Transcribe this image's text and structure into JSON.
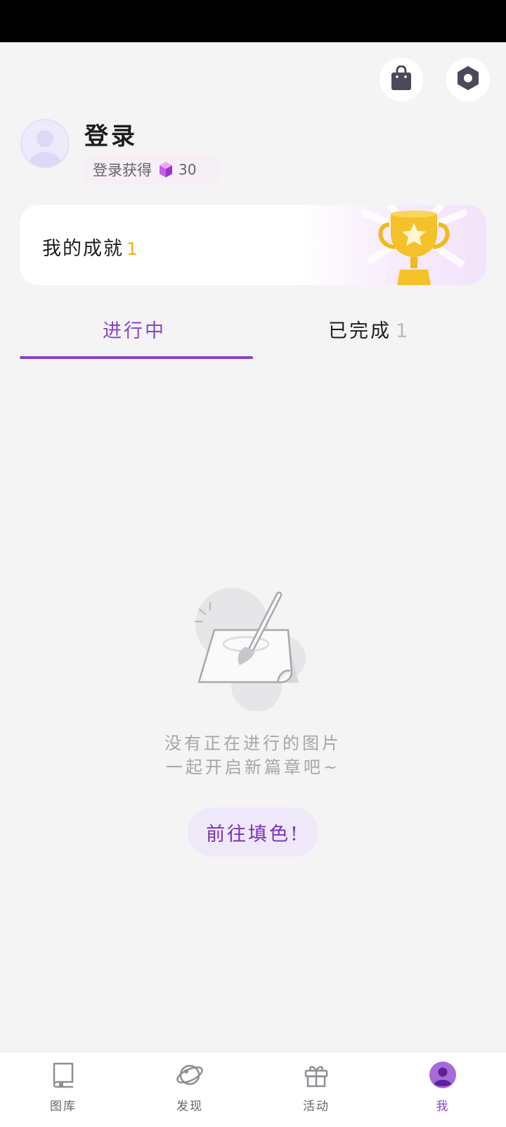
{
  "header": {
    "shop_icon": "shopping-bag-icon",
    "settings_icon": "hexagon-settings-icon"
  },
  "profile": {
    "login_label": "登录",
    "reward_text": "登录获得",
    "reward_amount": "30",
    "reward_icon": "purple-gem-icon"
  },
  "achievement": {
    "label": "我的成就",
    "count": "1",
    "icon": "trophy-icon"
  },
  "tabs": [
    {
      "label": "进行中",
      "count": "",
      "active": true
    },
    {
      "label": "已完成",
      "count": "1",
      "active": false
    }
  ],
  "empty_state": {
    "line1": "没有正在进行的图片",
    "line2": "一起开启新篇章吧~",
    "button_label": "前往填色!",
    "illustration": "paper-brush-icon"
  },
  "bottom_nav": [
    {
      "label": "图库",
      "icon": "gallery-book-icon",
      "active": false
    },
    {
      "label": "发现",
      "icon": "planet-icon",
      "active": false
    },
    {
      "label": "活动",
      "icon": "gift-icon",
      "active": false
    },
    {
      "label": "我",
      "icon": "user-icon",
      "active": true
    }
  ],
  "colors": {
    "accent": "#8a44c8",
    "background": "#f4f4f5",
    "achievement_count": "#f0b01c"
  }
}
